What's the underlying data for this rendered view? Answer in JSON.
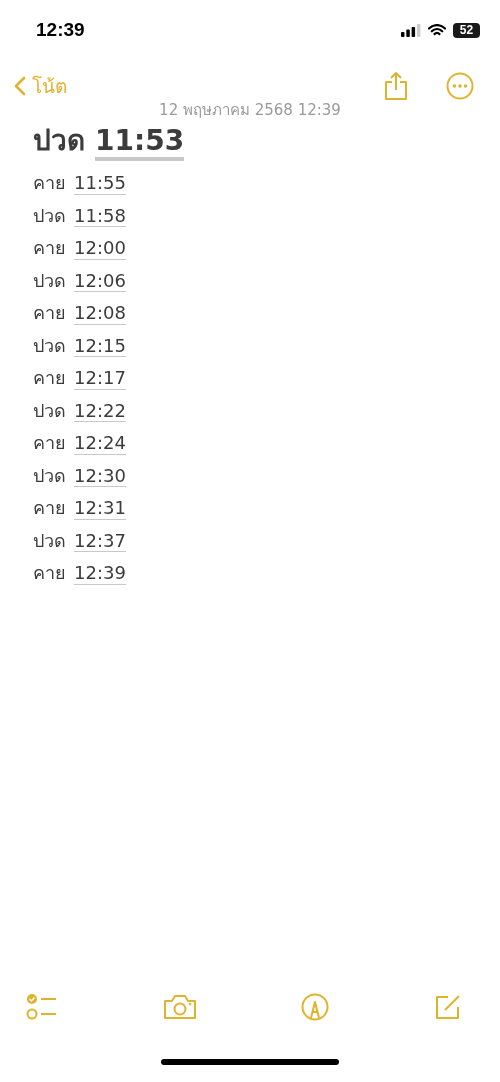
{
  "status_bar": {
    "time": "12:39",
    "battery": "52"
  },
  "nav": {
    "back_label": "โน้ต"
  },
  "note": {
    "date": "12 พฤษภาคม 2568 12:39",
    "title": {
      "label": "ปวด",
      "time": "11:53"
    },
    "lines": [
      {
        "label": "คาย",
        "time": "11:55"
      },
      {
        "label": "ปวด",
        "time": "11:58"
      },
      {
        "label": "คาย",
        "time": "12:00"
      },
      {
        "label": "ปวด",
        "time": "12:06"
      },
      {
        "label": "คาย",
        "time": "12:08"
      },
      {
        "label": "ปวด",
        "time": "12:15"
      },
      {
        "label": "คาย",
        "time": "12:17"
      },
      {
        "label": "ปวด",
        "time": "12:22"
      },
      {
        "label": "คาย",
        "time": "12:24"
      },
      {
        "label": "ปวด",
        "time": "12:30"
      },
      {
        "label": "คาย",
        "time": "12:31"
      },
      {
        "label": "ปวด",
        "time": "12:37"
      },
      {
        "label": "คาย",
        "time": "12:39"
      }
    ]
  }
}
